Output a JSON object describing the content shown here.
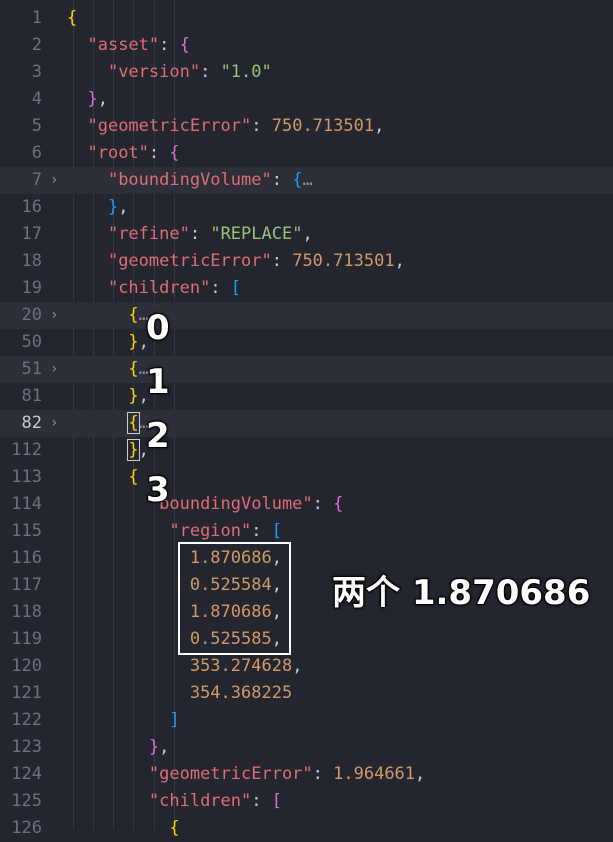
{
  "editor": {
    "top_partial_text": "...",
    "lines": [
      {
        "n": "1",
        "html": "b1:{"
      },
      {
        "n": "2"
      },
      {
        "n": "3"
      }
    ]
  },
  "annotations": {
    "index_labels": [
      "0",
      "1",
      "2",
      "3"
    ],
    "region_note": "两个 1.870686"
  },
  "colors": {
    "background": "#23262e",
    "key": "#e06c75",
    "string": "#98c379",
    "number": "#d19a66",
    "bracket_level1": "#ffd700",
    "bracket_level2": "#da70d6",
    "bracket_level3": "#179fff"
  }
}
